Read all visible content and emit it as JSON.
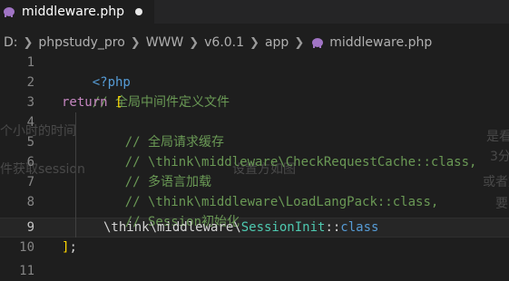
{
  "tab": {
    "file_name": "middleware.php",
    "icon": "php-elephant-icon",
    "modified_indicator": "dot"
  },
  "breadcrumb": {
    "segments": [
      "D:",
      "phpstudy_pro",
      "WWW",
      "v6.0.1",
      "app"
    ],
    "file": "middleware.php"
  },
  "editor": {
    "line_numbers": [
      "1",
      "2",
      "3",
      "4",
      "5",
      "6",
      "7",
      "8",
      "9",
      "10",
      "11"
    ],
    "active_line": "9",
    "lines": {
      "l1": "<?php",
      "l2": "// 全局中间件定义文件",
      "l3_kw": "return",
      "l3_br": "[",
      "l4": "// 全局请求缓存",
      "l5": "// \\think\\middleware\\CheckRequestCache::class,",
      "l6": "// 多语言加载",
      "l7": "// \\think\\middleware\\LoadLangPack::class,",
      "l8": "// Session初始化",
      "l9_ns": "\\think\\middleware\\",
      "l9_class": "SessionInit",
      "l9_sep": "::",
      "l9_const": "class",
      "l10_br": "]",
      "l10_semi": ";"
    }
  },
  "ghost_text": {
    "g1": "个小时的时间",
    "g2": "件获取session",
    "g3": "设置方如图",
    "g4": "是看b",
    "g5": "3分",
    "g6": "或者文",
    "g7": "要"
  },
  "colors": {
    "background": "#1e1e1e",
    "comment": "#6a9955",
    "keyword": "#c586c0",
    "tag": "#569cd6",
    "bracket": "#ffd700",
    "class": "#4ec9b0"
  }
}
